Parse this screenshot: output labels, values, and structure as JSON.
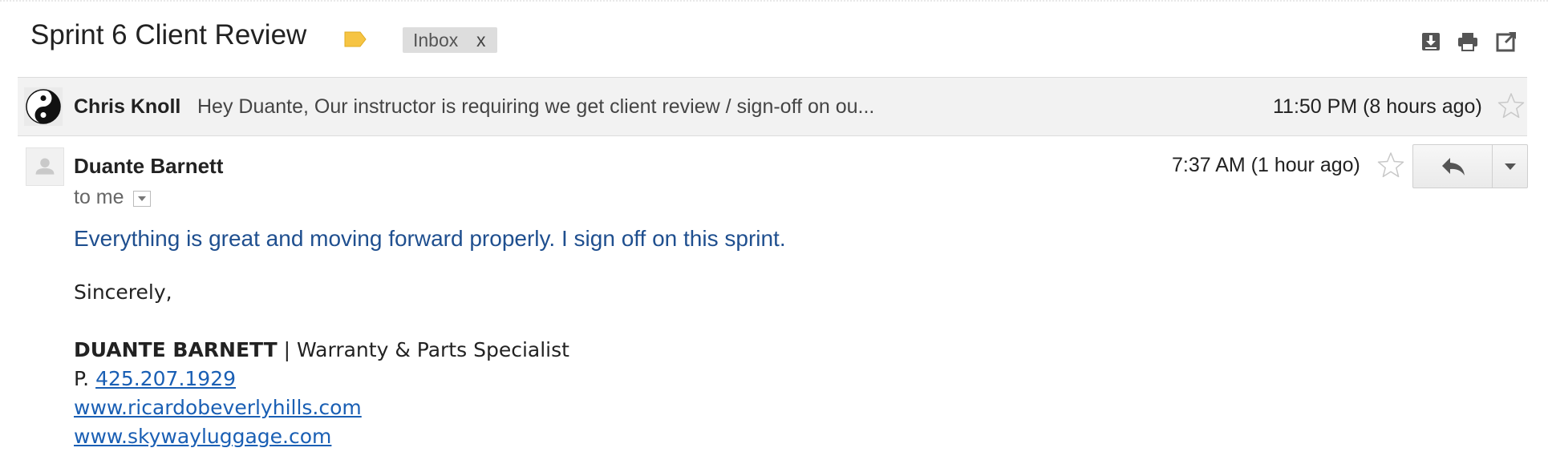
{
  "thread": {
    "subject": "Sprint 6 Client Review",
    "label_color": "#f6c443",
    "chip": {
      "label": "Inbox",
      "remove": "x"
    },
    "toolbar_icons": [
      "download-icon",
      "print-icon",
      "new-window-icon"
    ]
  },
  "collapsed_message": {
    "sender": "Chris Knoll",
    "snippet": "Hey Duante, Our instructor is requiring we get client review / sign-off on ou...",
    "time": "11:50 PM (8 hours ago)",
    "avatar": "yin-yang-icon"
  },
  "message": {
    "sender": "Duante Barnett",
    "recipient_label": "to me",
    "time": "7:37 AM (1 hour ago)",
    "body_line": "Everything is great and moving forward properly. I sign off on this sprint.",
    "closing": "Sincerely,",
    "signature": {
      "name": "DUANTE BARNETT",
      "title": " | Warranty & Parts Specialist",
      "phone_prefix": "P. ",
      "phone": "425.207.1929",
      "website1": "www.ricardobeverlyhills.com",
      "website2": "www.skywayluggage.com"
    }
  },
  "colors": {
    "body_text_blue": "#1f4f8f",
    "link_blue": "#1a5fb4",
    "collapsed_bg": "#f2f2f2"
  }
}
